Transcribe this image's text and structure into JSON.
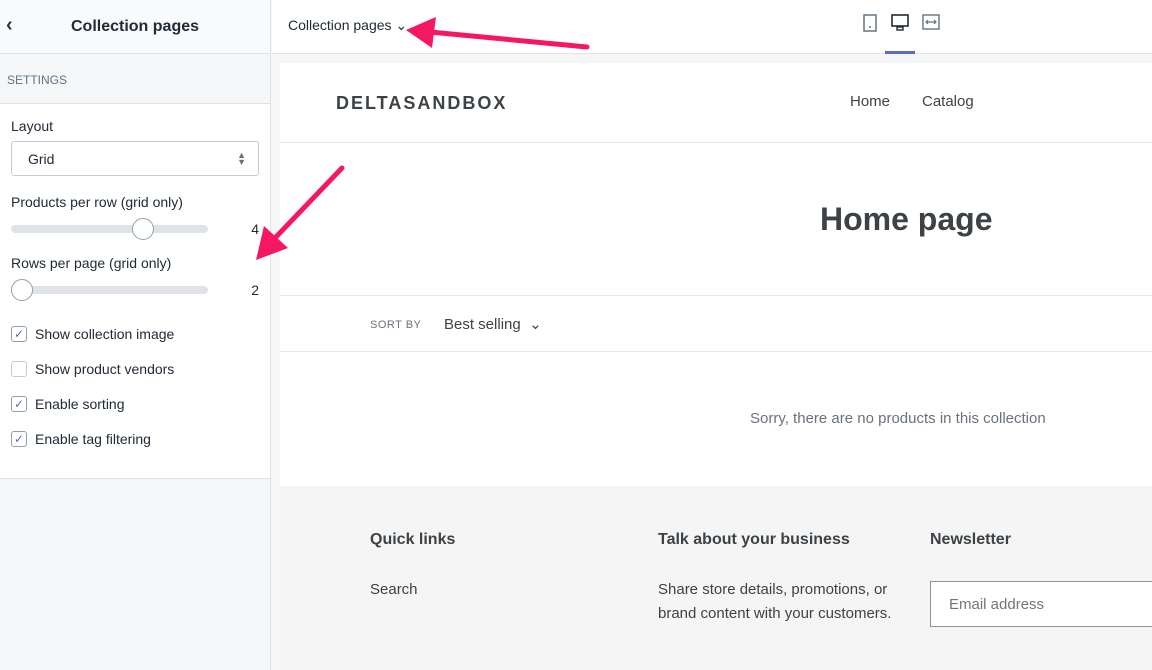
{
  "sidebar": {
    "title": "Collection pages",
    "section": "SETTINGS",
    "layout_label": "Layout",
    "layout_value": "Grid",
    "products_per_row": {
      "label": "Products per row (grid only)",
      "value": "4",
      "fraction": 0.67
    },
    "rows_per_page": {
      "label": "Rows per page (grid only)",
      "value": "2",
      "fraction": 0
    },
    "checkboxes": [
      {
        "label": "Show collection image",
        "checked": true
      },
      {
        "label": "Show product vendors",
        "checked": false
      },
      {
        "label": "Enable sorting",
        "checked": true
      },
      {
        "label": "Enable tag filtering",
        "checked": true
      }
    ]
  },
  "topbar": {
    "page_select": "Collection pages",
    "devices": [
      "mobile-icon",
      "desktop-icon",
      "fullscreen-icon"
    ],
    "active_device": "desktop"
  },
  "preview": {
    "logo": "DELTASANDBOX",
    "nav": [
      "Home",
      "Catalog"
    ],
    "heading": "Home page",
    "sort_label": "SORT BY",
    "sort_value": "Best selling",
    "empty_message": "Sorry, there are no products in this collection",
    "footer": {
      "quick_links_title": "Quick links",
      "quick_links": [
        "Search"
      ],
      "about_title": "Talk about your business",
      "about_text": "Share store details, promotions, or brand content with your customers.",
      "newsletter_title": "Newsletter",
      "email_placeholder": "Email address"
    }
  },
  "colors": {
    "accent": "#5c6ac4",
    "annotation_arrow": "#f5175f"
  }
}
